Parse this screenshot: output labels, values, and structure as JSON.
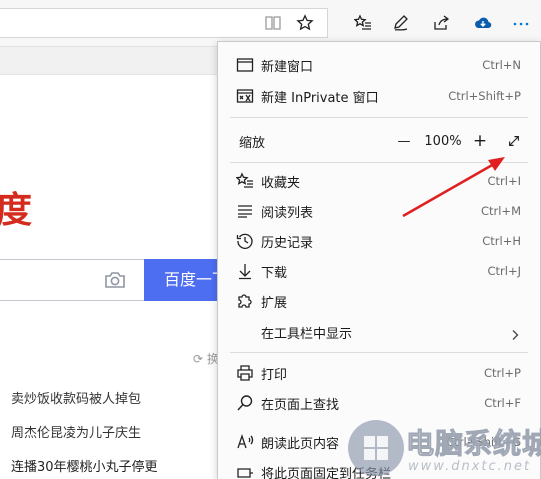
{
  "page": {
    "logo_fragment": "度",
    "search_button": "百度一下",
    "refresh_label": "换",
    "news": [
      "卖炒饭收款码被人掉包",
      "周杰伦昆凌为儿子庆生",
      "连播30年樱桃小丸子停更"
    ]
  },
  "menu": {
    "new_window": {
      "label": "新建窗口",
      "shortcut": "Ctrl+N"
    },
    "new_private": {
      "label": "新建 InPrivate 窗口",
      "shortcut": "Ctrl+Shift+P"
    },
    "zoom": {
      "label": "缩放",
      "minus": "—",
      "value": "100%",
      "plus": "+"
    },
    "favorites": {
      "label": "收藏夹",
      "shortcut": "Ctrl+I"
    },
    "reading_list": {
      "label": "阅读列表",
      "shortcut": "Ctrl+M"
    },
    "history": {
      "label": "历史记录",
      "shortcut": "Ctrl+H"
    },
    "downloads": {
      "label": "下载",
      "shortcut": "Ctrl+J"
    },
    "extensions": {
      "label": "扩展"
    },
    "show_in_toolbar": {
      "label": "在工具栏中显示"
    },
    "print": {
      "label": "打印",
      "shortcut": "Ctrl+P"
    },
    "find": {
      "label": "在页面上查找",
      "shortcut": "Ctrl+F"
    },
    "read_aloud": {
      "label": "朗读此页内容",
      "shortcut": "Ctrl+Shift+G"
    },
    "pin": {
      "label": "将此页面固定到任务栏"
    }
  },
  "watermark": {
    "text": "电脑系统城",
    "url": "www.dnxtc.net"
  },
  "colors": {
    "accent": "#0078d7",
    "search_button": "#4e6ef2",
    "logo_red": "#d52a1e",
    "annotation_arrow": "#e02020"
  }
}
